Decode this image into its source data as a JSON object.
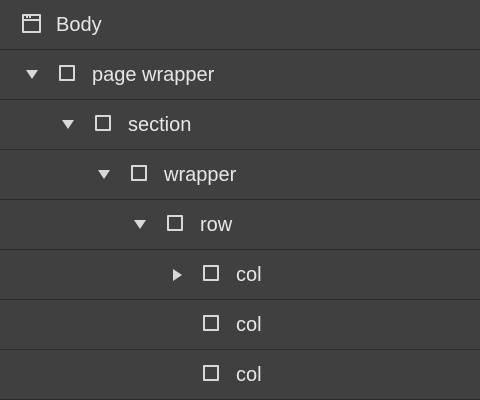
{
  "navigator": {
    "items": [
      {
        "label": "Body",
        "icon": "browser-window-icon",
        "expander": "none"
      },
      {
        "label": "page wrapper",
        "icon": "div-block-icon",
        "expander": "expanded"
      },
      {
        "label": "section",
        "icon": "div-block-icon",
        "expander": "expanded"
      },
      {
        "label": "wrapper",
        "icon": "div-block-icon",
        "expander": "expanded"
      },
      {
        "label": "row",
        "icon": "div-block-icon",
        "expander": "expanded"
      },
      {
        "label": "col",
        "icon": "div-block-icon",
        "expander": "collapsed"
      },
      {
        "label": "col",
        "icon": "div-block-icon",
        "expander": "none"
      },
      {
        "label": "col",
        "icon": "div-block-icon",
        "expander": "none"
      }
    ]
  },
  "colors": {
    "background": "#404040",
    "divider": "#2b2b2b",
    "text": "#e6e6e6",
    "icon": "#d8d8d8"
  }
}
